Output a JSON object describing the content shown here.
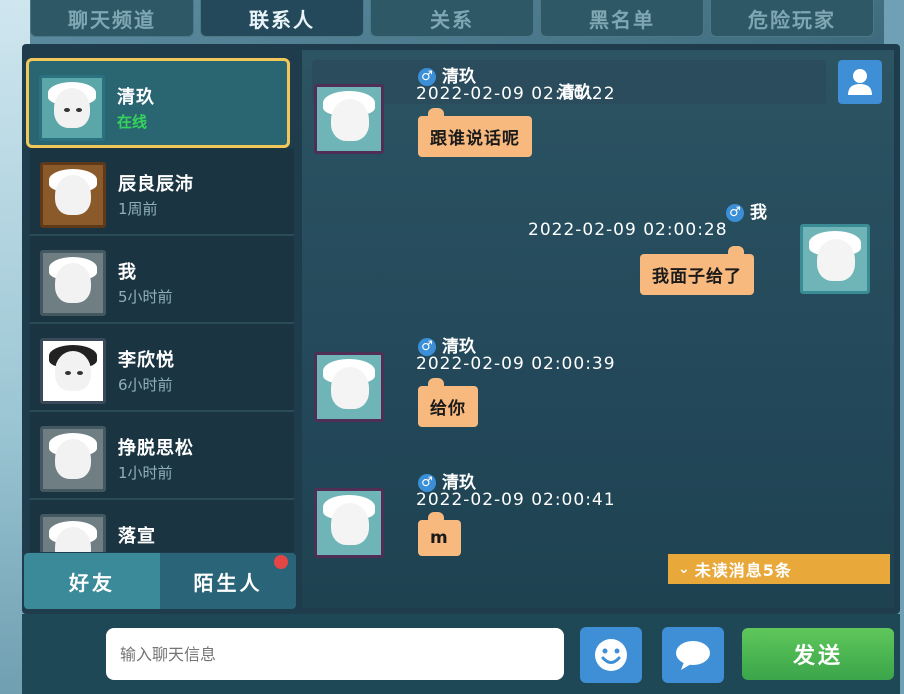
{
  "top_tabs": [
    {
      "label": "聊天频道",
      "active": false
    },
    {
      "label": "联系人",
      "active": true
    },
    {
      "label": "关系",
      "active": false
    },
    {
      "label": "黑名单",
      "active": false
    },
    {
      "label": "危险玩家",
      "active": false
    }
  ],
  "contacts": [
    {
      "name": "清玖",
      "status": "在线",
      "online": true
    },
    {
      "name": "辰良辰沛",
      "status": "1周前",
      "online": false
    },
    {
      "name": "我",
      "status": "5小时前",
      "online": false
    },
    {
      "name": "李欣悦",
      "status": "6小时前",
      "online": false
    },
    {
      "name": "挣脱思松",
      "status": "1小时前",
      "online": false
    },
    {
      "name": "落宣",
      "status": "",
      "online": false
    }
  ],
  "list_tabs": {
    "friends": "好友",
    "strangers": "陌生人"
  },
  "chat": {
    "header_title": "清玖",
    "messages": [
      {
        "sender": "清玖",
        "time": "2022-02-09  02:00:22",
        "text": "跟谁说话呢",
        "mine": false
      },
      {
        "sender": "我",
        "time": "2022-02-09  02:00:28",
        "text": "我面子给了",
        "mine": true
      },
      {
        "sender": "清玖",
        "time": "2022-02-09  02:00:39",
        "text": "给你",
        "mine": false
      },
      {
        "sender": "清玖",
        "time": "2022-02-09  02:00:41",
        "text": "m",
        "mine": false
      }
    ],
    "unread": "未读消息5条"
  },
  "input": {
    "placeholder": "输入聊天信息"
  },
  "send_label": "发送",
  "icons": {
    "male": "male-icon",
    "profile": "user-profile-icon",
    "emoji": "smiley-icon",
    "bubble": "speech-bubble-icon"
  },
  "colors": {
    "accent": "#3f8fd6",
    "send": "#4ab54f",
    "bubble": "#f8b97e",
    "unread": "#e8a83a",
    "online": "#35d35a",
    "selected_border": "#f1c759"
  }
}
